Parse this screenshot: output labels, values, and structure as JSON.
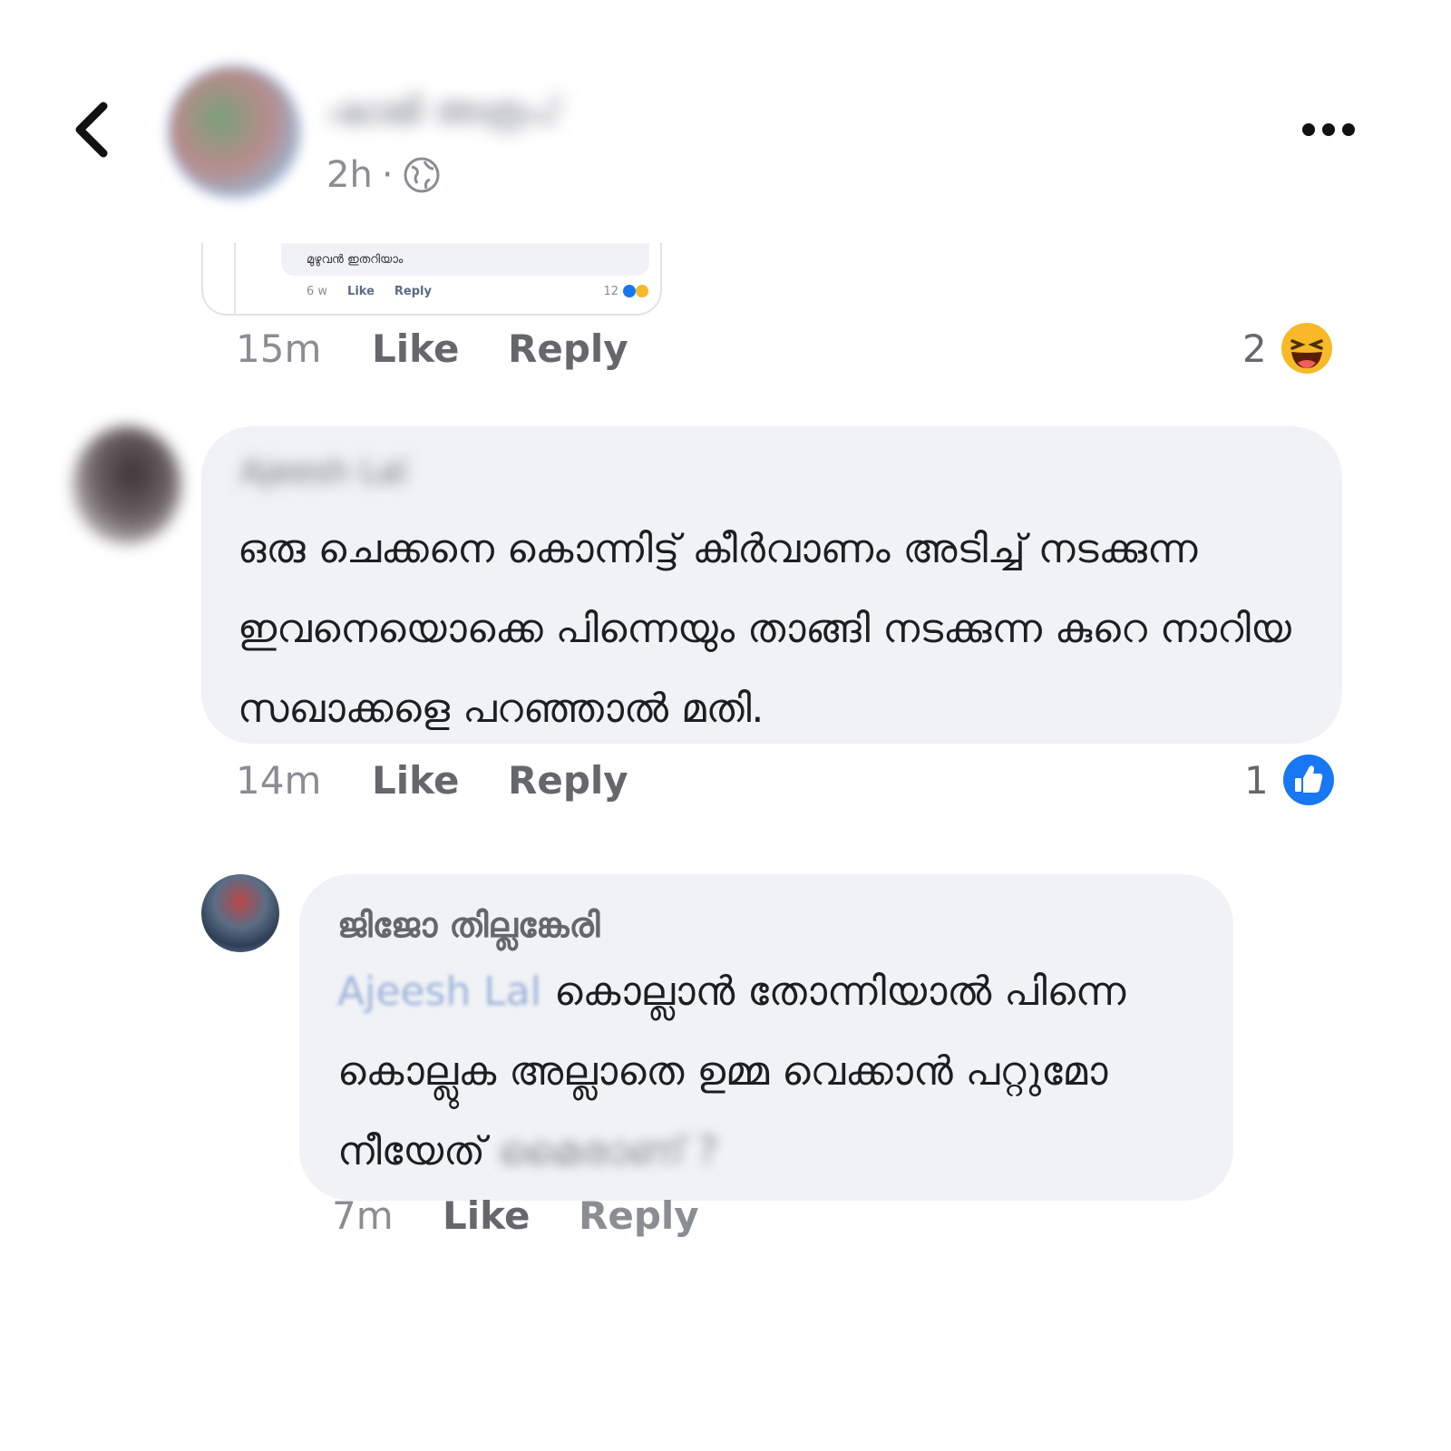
{
  "header": {
    "author_name": "ഷാജി അരൂപ്",
    "post_time": "2h",
    "separator": "·",
    "audience_icon": "globe-icon",
    "back_icon": "chevron-left-icon",
    "more_icon": "more-horizontal-icon"
  },
  "quoted": {
    "text": "മുഴുവൻ ഇതറിയാം",
    "time": "6 w",
    "like_label": "Like",
    "reply_label": "Reply",
    "reaction_count": "12"
  },
  "comments": [
    {
      "author_name": "Ajeesh Lal",
      "text": "ഒരു ചെക്കനെ കൊന്നിട്ട് കീർവാണം അടിച്ച് നടക്കുന്ന ഇവനെയൊക്കെ പിന്നെയും താങ്ങി നടക്കുന്ന കുറെ നാറിയ സഖാക്കളെ പറഞ്ഞാൽ മതി.",
      "time": "14m",
      "like_label": "Like",
      "reply_label": "Reply",
      "reaction_count": "1",
      "reaction_icon": "like-reaction-icon"
    }
  ],
  "parent_actions": {
    "time": "15m",
    "like_label": "Like",
    "reply_label": "Reply",
    "reaction_count": "2",
    "reaction_icon": "haha-reaction-icon"
  },
  "reply": {
    "author_name": "ജിജോ തില്ലങ്കേരി",
    "mention": "Ajeesh Lal",
    "text": "കൊല്ലാൻ തോന്നിയാൽ പിന്നെ കൊല്ലുക അല്ലാതെ ഉമ്മ വെക്കാൻ പറ്റുമോ നീയേത്",
    "blurred_tail": "മൈരാണ് ?",
    "time": "7m",
    "like_label": "Like",
    "reply_label": "Reply"
  },
  "colors": {
    "bubble": "#f0f2f5",
    "muted_text": "#65676b",
    "like_blue": "#1877f2",
    "haha_yellow": "#f7b928"
  }
}
